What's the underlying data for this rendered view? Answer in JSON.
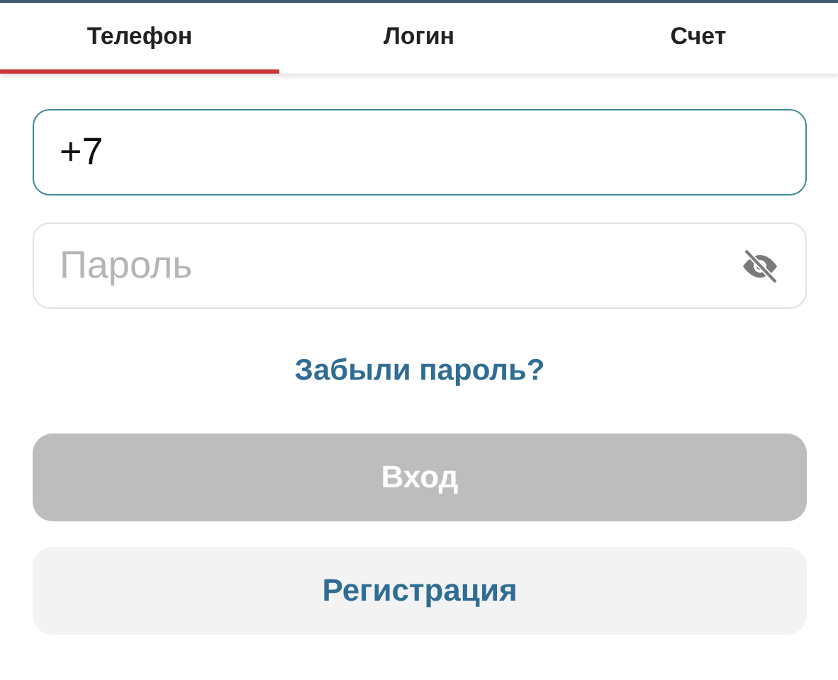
{
  "tabs": [
    {
      "label": "Телефон",
      "selected": true
    },
    {
      "label": "Логин",
      "selected": false
    },
    {
      "label": "Счет",
      "selected": false
    }
  ],
  "phone": {
    "value": "+7",
    "focused": true
  },
  "password": {
    "placeholder": "Пароль",
    "focused": false
  },
  "forgot_link": "Забыли пароль?",
  "login_button": {
    "label": "Вход",
    "disabled": true
  },
  "register_button": "Регистрация"
}
